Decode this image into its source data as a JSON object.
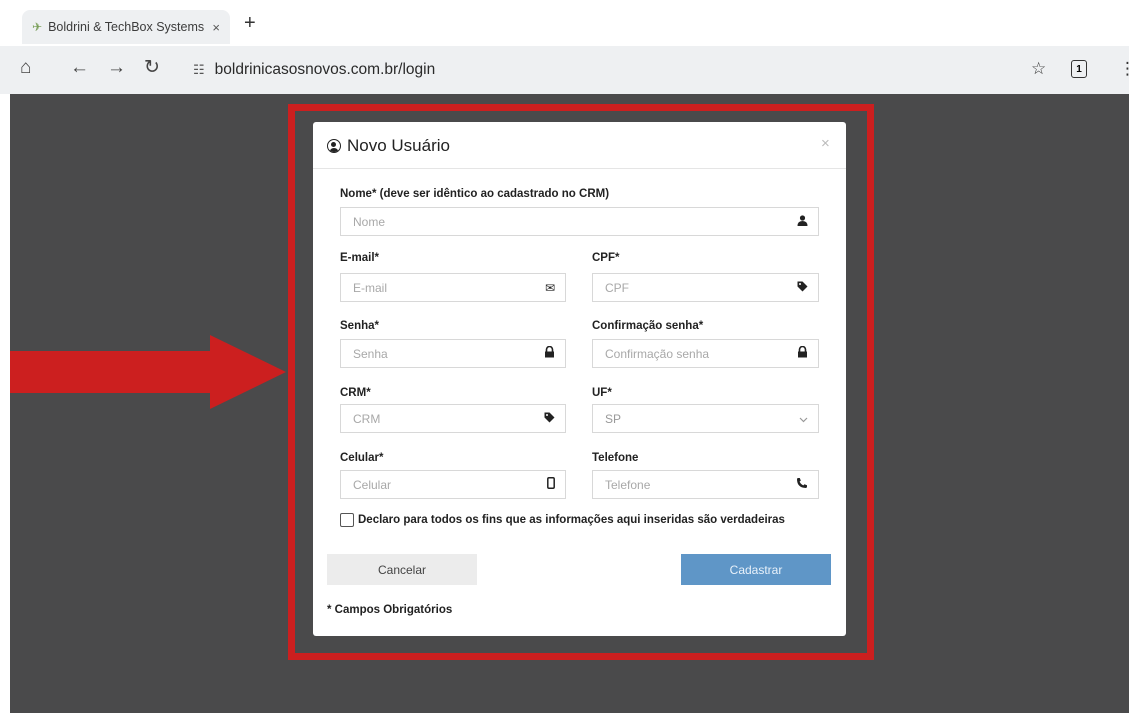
{
  "browser": {
    "tab_title": "Boldrini & TechBox Systems",
    "tab_close": "×",
    "new_tab": "+",
    "url": "boldrinicasosnovos.com.br/login",
    "extension_badge": "1"
  },
  "modal": {
    "title": "Novo Usuário",
    "close": "×",
    "fields": {
      "nome": {
        "label": "Nome* (deve ser idêntico ao cadastrado no CRM)",
        "placeholder": "Nome"
      },
      "email": {
        "label": "E-mail*",
        "placeholder": "E-mail"
      },
      "cpf": {
        "label": "CPF*",
        "placeholder": "CPF"
      },
      "senha": {
        "label": "Senha*",
        "placeholder": "Senha"
      },
      "confirmacao": {
        "label": "Confirmação senha*",
        "placeholder": "Confirmação senha"
      },
      "crm": {
        "label": "CRM*",
        "placeholder": "CRM"
      },
      "uf": {
        "label": "UF*",
        "value": "SP"
      },
      "celular": {
        "label": "Celular*",
        "placeholder": "Celular"
      },
      "telefone": {
        "label": "Telefone",
        "placeholder": "Telefone"
      }
    },
    "declaration": "Declaro para todos os fins que as informações aqui inseridas são verdadeiras",
    "cancel_label": "Cancelar",
    "submit_label": "Cadastrar",
    "required_note": "* Campos Obrigatórios"
  },
  "colors": {
    "highlight": "#cc1f1f",
    "arrow": "#cc1f1f",
    "submit_button": "#5f96c7",
    "overlay": "#4a4a4b"
  },
  "icons": [
    "home-icon",
    "back-icon",
    "forward-icon",
    "reload-icon",
    "site-info-icon",
    "star-icon",
    "user-icon",
    "envelope-icon",
    "tag-icon",
    "lock-icon",
    "mobile-icon",
    "phone-icon",
    "chevron-down-icon"
  ]
}
